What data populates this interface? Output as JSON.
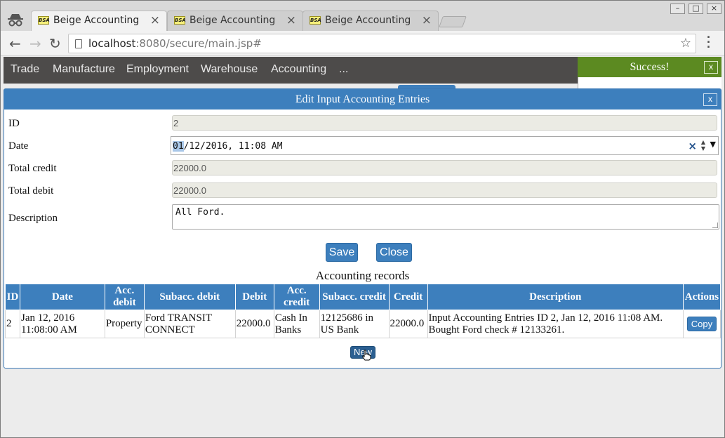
{
  "browser": {
    "tabs": [
      {
        "favicon": "BSA",
        "title": "Beige Accounting",
        "close": "×",
        "active": true
      },
      {
        "favicon": "BSA",
        "title": "Beige Accounting",
        "close": "×",
        "active": false
      },
      {
        "favicon": "BSA",
        "title": "Beige Accounting",
        "close": "×",
        "active": false
      }
    ],
    "url_host": "localhost",
    "url_rest": ":8080/secure/main.jsp#",
    "window_controls": {
      "minimize": "–",
      "maximize": "□",
      "close": "×"
    }
  },
  "app_nav": {
    "items": [
      "Trade",
      "Manufacture",
      "Employment",
      "Warehouse",
      "Accounting",
      "..."
    ]
  },
  "notification": {
    "message": "Success!",
    "close": "x",
    "color": "#5c8a21"
  },
  "dialog": {
    "title": "Edit Input Accounting Entries",
    "close": "x",
    "fields": {
      "id": {
        "label": "ID",
        "value": "2"
      },
      "date": {
        "label": "Date",
        "value_selected": "01",
        "value_rest": "/12/2016, 11:08 AM"
      },
      "total_credit": {
        "label": "Total credit",
        "value": "22000.0"
      },
      "total_debit": {
        "label": "Total debit",
        "value": "22000.0"
      },
      "description": {
        "label": "Description",
        "value": "All Ford."
      }
    },
    "buttons": {
      "save": "Save",
      "close": "Close"
    },
    "records": {
      "title": "Accounting records",
      "columns": [
        "ID",
        "Date",
        "Acc. debit",
        "Subacc. debit",
        "Debit",
        "Acc. credit",
        "Subacc. credit",
        "Credit",
        "Description",
        "Actions"
      ],
      "rows": [
        {
          "id": "2",
          "date": "Jan 12, 2016 11:08:00 AM",
          "acc_debit": "Property",
          "subacc_debit": "Ford TRANSIT CONNECT",
          "debit": "22000.0",
          "acc_credit": "Cash In Banks",
          "subacc_credit": "12125686 in US Bank",
          "credit": "22000.0",
          "description": "Input Accounting Entries ID 2, Jan 12, 2016 11:08 AM. Bought Ford check # 12133261.",
          "action": "Copy"
        }
      ],
      "new_button": "New"
    }
  },
  "colors": {
    "primary": "#3d7fbd",
    "nav_bg": "#4d4b4a",
    "success": "#5c8a21"
  }
}
